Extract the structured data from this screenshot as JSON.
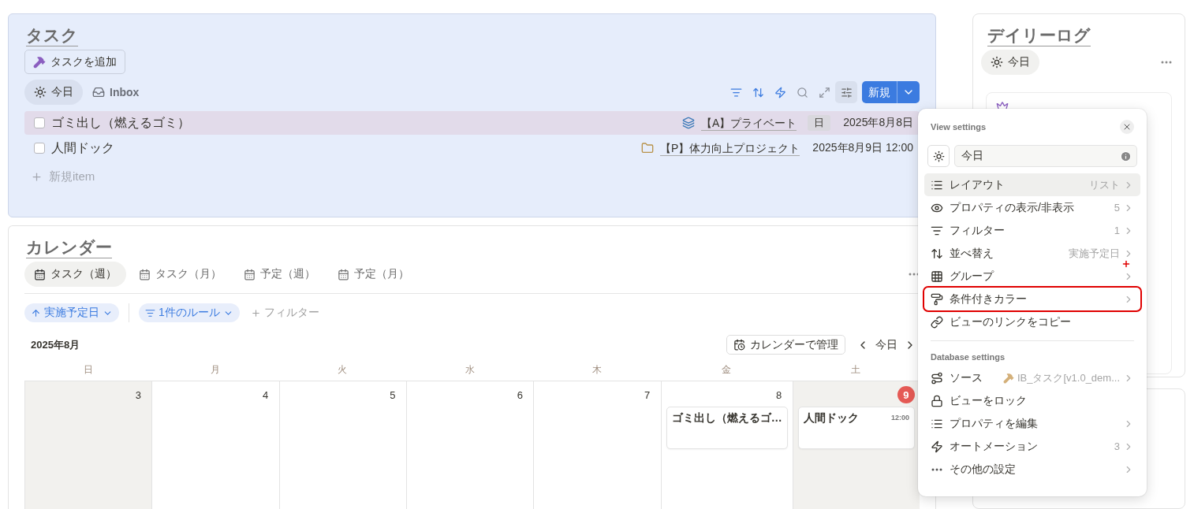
{
  "tasks": {
    "title": "タスク",
    "add_button": "タスクを追加",
    "views": [
      {
        "label": "今日",
        "selected": true
      },
      {
        "label": "Inbox",
        "selected": false
      }
    ],
    "new_button": "新規",
    "items": [
      {
        "title": "ゴミ出し（燃えるゴミ）",
        "checked": false,
        "highlighted": true,
        "project": "【A】プライベート",
        "tag": "日",
        "date": "2025年8月8日"
      },
      {
        "title": "人間ドック",
        "checked": false,
        "highlighted": false,
        "project": "【P】体力向上プロジェクト",
        "date": "2025年8月9日 12:00"
      }
    ],
    "new_item": "新規item"
  },
  "calendar": {
    "title": "カレンダー",
    "views": [
      {
        "label": "タスク（週）",
        "selected": true
      },
      {
        "label": "タスク（月）",
        "selected": false
      },
      {
        "label": "予定（週）",
        "selected": false
      },
      {
        "label": "予定（月）",
        "selected": false
      }
    ],
    "chips": [
      {
        "kind": "sort",
        "label": "実施予定日"
      },
      {
        "kind": "filter",
        "label": "1件のルール"
      }
    ],
    "add_filter": "フィルター",
    "month": "2025年8月",
    "manage_button": "カレンダーで管理",
    "today_button": "今日",
    "weekdays": [
      "日",
      "月",
      "火",
      "水",
      "木",
      "金",
      "土"
    ],
    "days": [
      {
        "number": "3",
        "weekend": true,
        "today": false
      },
      {
        "number": "4",
        "weekend": false,
        "today": false
      },
      {
        "number": "5",
        "weekend": false,
        "today": false
      },
      {
        "number": "6",
        "weekend": false,
        "today": false
      },
      {
        "number": "7",
        "weekend": false,
        "today": false
      },
      {
        "number": "8",
        "weekend": false,
        "today": false,
        "events": [
          {
            "title": "ゴミ出し（燃えるゴ…"
          }
        ]
      },
      {
        "number": "9",
        "weekend": true,
        "today": true,
        "events": [
          {
            "title": "人間ドック",
            "time": "12:00"
          }
        ]
      }
    ]
  },
  "daily_log": {
    "title": "デイリーログ",
    "view": {
      "label": "今日",
      "selected": true
    }
  },
  "view_settings": {
    "title": "View settings",
    "view_name": "今日",
    "sections": [
      {
        "items": [
          {
            "label": "レイアウト",
            "value": "リスト",
            "chevron": true,
            "hovered": true,
            "highlighted": false
          },
          {
            "label": "プロパティの表示/非表示",
            "value": "5",
            "chevron": true,
            "hovered": false,
            "highlighted": false
          },
          {
            "label": "フィルター",
            "value": "1",
            "chevron": true,
            "hovered": false,
            "highlighted": false
          },
          {
            "label": "並べ替え",
            "value": "実施予定日",
            "chevron": true,
            "hovered": false,
            "highlighted": false
          },
          {
            "label": "グループ",
            "chevron": true,
            "hovered": false,
            "highlighted": false
          },
          {
            "label": "条件付きカラー",
            "chevron": true,
            "hovered": false,
            "highlighted": true
          },
          {
            "label": "ビューのリンクをコピー",
            "chevron": false,
            "hovered": false,
            "highlighted": false
          }
        ]
      },
      {
        "heading": "Database settings",
        "items": [
          {
            "label": "ソース",
            "value": "IB_タスク[v1.0_dem...",
            "chevron": true,
            "hovered": false,
            "highlighted": false
          },
          {
            "label": "ビューをロック",
            "chevron": false,
            "hovered": false,
            "highlighted": false
          },
          {
            "label": "プロパティを編集",
            "chevron": true,
            "hovered": false,
            "highlighted": false
          },
          {
            "label": "オートメーション",
            "value": "3",
            "chevron": true,
            "hovered": false,
            "highlighted": false
          },
          {
            "label": "その他の設定",
            "chevron": true,
            "hovered": false,
            "highlighted": false
          }
        ]
      }
    ]
  }
}
